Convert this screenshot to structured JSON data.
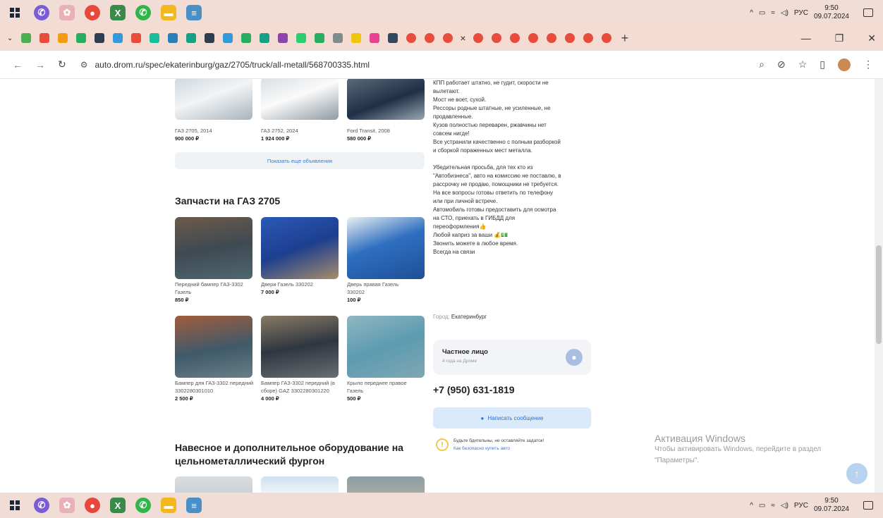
{
  "taskbar": {
    "lang": "РУС",
    "time": "9:50",
    "date": "09.07.2024",
    "icons": [
      "windows-icon",
      "viber-icon",
      "network-app-icon",
      "chrome-icon",
      "excel-icon",
      "whatsapp-icon",
      "file-explorer-icon",
      "notepad-icon"
    ]
  },
  "browser": {
    "url": "auto.drom.ru/spec/ekaterinburg/gaz/2705/truck/all-metall/568700335.html",
    "new_tab": "+",
    "close_tab": "×"
  },
  "similar": {
    "items": [
      {
        "title": "ГАЗ 2705, 2014",
        "price": "900 000 ₽"
      },
      {
        "title": "ГАЗ 2752, 2024",
        "price": "1 924 000 ₽"
      },
      {
        "title": "Ford Transit, 2008",
        "price": "580 000 ₽"
      }
    ],
    "more_label": "Показать еще объявления"
  },
  "parts": {
    "heading": "Запчасти на ГАЗ 2705",
    "items": [
      {
        "title": "Передний бампер ГАЗ-3302 Газель",
        "price": "850 ₽"
      },
      {
        "title": "Двери Газель 330202",
        "price": "7 000 ₽"
      },
      {
        "title": "Дверь правая Газель 330202",
        "price": "100 ₽"
      },
      {
        "title": "Бампер для ГАЗ-3302 передний 3302280301010",
        "price": "2 500 ₽"
      },
      {
        "title": "Бампер ГАЗ-3302 передний (в сборе) GAZ 3302280301220",
        "price": "4 000 ₽"
      },
      {
        "title": "Крыло переднее правое Газель",
        "price": "500 ₽"
      }
    ]
  },
  "equipment_heading": "Навесное и дополнительное оборудование на цельнометаллический фургон",
  "description": [
    "КПП работает штатно, не гудит, скорости не",
    "вылетают.",
    "Мост не воет, сухой.",
    "Рессоры родные штатные, не усиленные, не",
    "продавленные.",
    "Кузов полностью переварен, ржавчины нет",
    "совсем нигде!",
    "Все устранили качественно с полным разборкой",
    "и сборкой пораженных мест металла.",
    "",
    "Убедительная просьба, для тех кто из",
    "\"Автобизнеса\", авто на комиссию не поставлю, в",
    "рассрочку не продаю, помощники не требуется.",
    "На все вопросы готовы ответить по телефону",
    "или при личной встрече.",
    "Автомобиль готовы предоставить для осмотра",
    "на СТО, приехать в ГИБДД для",
    "переоформления👍",
    "Любой каприз за ваши 💰💵",
    "Звонить можете в любое время.",
    "Всегда на связи"
  ],
  "city_label": "Город:",
  "city": "Екатеринбург",
  "seller": {
    "name": "Частное лицо",
    "since": "4 года на Дроме"
  },
  "phone": "+7 (950) 631-1819",
  "message_button": "Написать сообщение",
  "warning": {
    "text": "Будьте бдительны, не оставляйте задаток!",
    "link": "Как безопасно купить авто"
  },
  "activation": {
    "title": "Активация Windows",
    "subtitle": "Чтобы активировать Windows, перейдите в раздел \"Параметры\"."
  }
}
